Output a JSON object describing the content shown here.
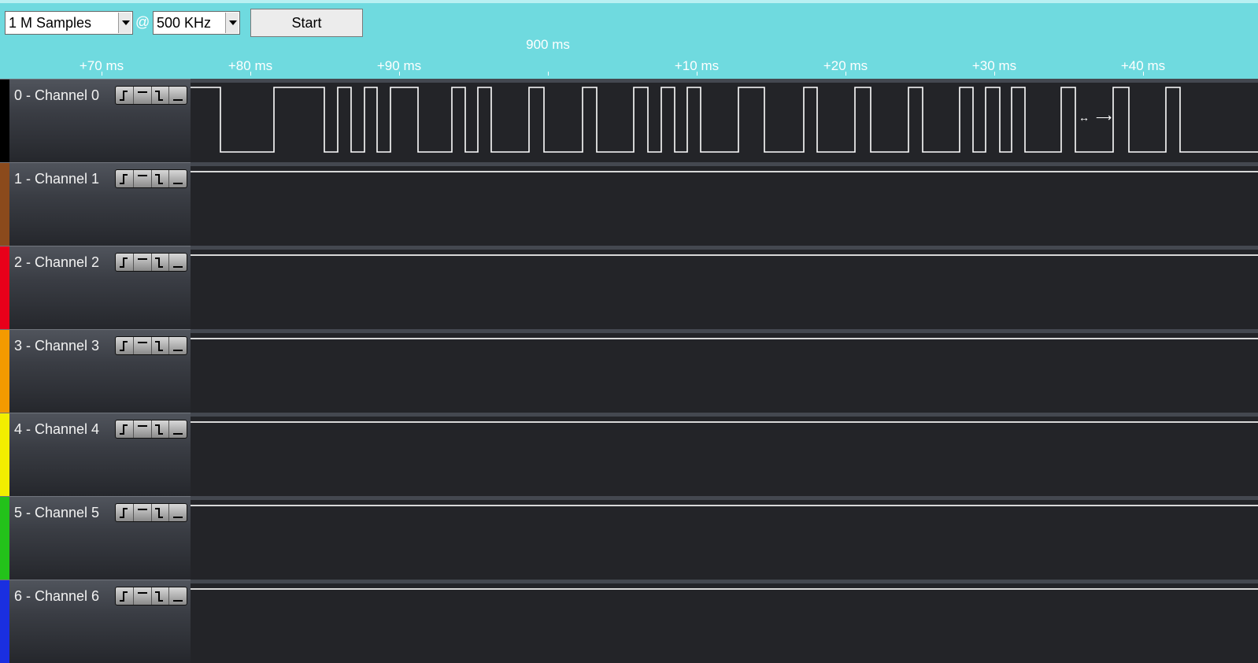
{
  "toolbar": {
    "samples_value": "1 M Samples",
    "at_symbol": "@",
    "frequency_value": "500 KHz",
    "start_label": "Start"
  },
  "timeline": {
    "center_label": "900 ms",
    "ticks": [
      "+70 ms",
      "+80 ms",
      "+90 ms",
      "+10 ms",
      "+20 ms",
      "+30 ms",
      "+40 ms"
    ]
  },
  "channels": [
    {
      "name": "0 - Channel 0",
      "color": "#000000"
    },
    {
      "name": "1 - Channel 1",
      "color": "#8b4a1c"
    },
    {
      "name": "2 - Channel 2",
      "color": "#e8001a"
    },
    {
      "name": "3 - Channel 3",
      "color": "#f39a00"
    },
    {
      "name": "4 - Channel 4",
      "color": "#f2ee00"
    },
    {
      "name": "5 - Channel 5",
      "color": "#23c21a"
    },
    {
      "name": "6 - Channel 6",
      "color": "#1a2fe0"
    }
  ],
  "trigger_buttons": [
    "rising-edge",
    "high-level",
    "falling-edge",
    "low-level"
  ],
  "colors": {
    "toolbar_bg": "#6fdadf",
    "plot_bg": "#232428",
    "signal": "#ffffff"
  }
}
